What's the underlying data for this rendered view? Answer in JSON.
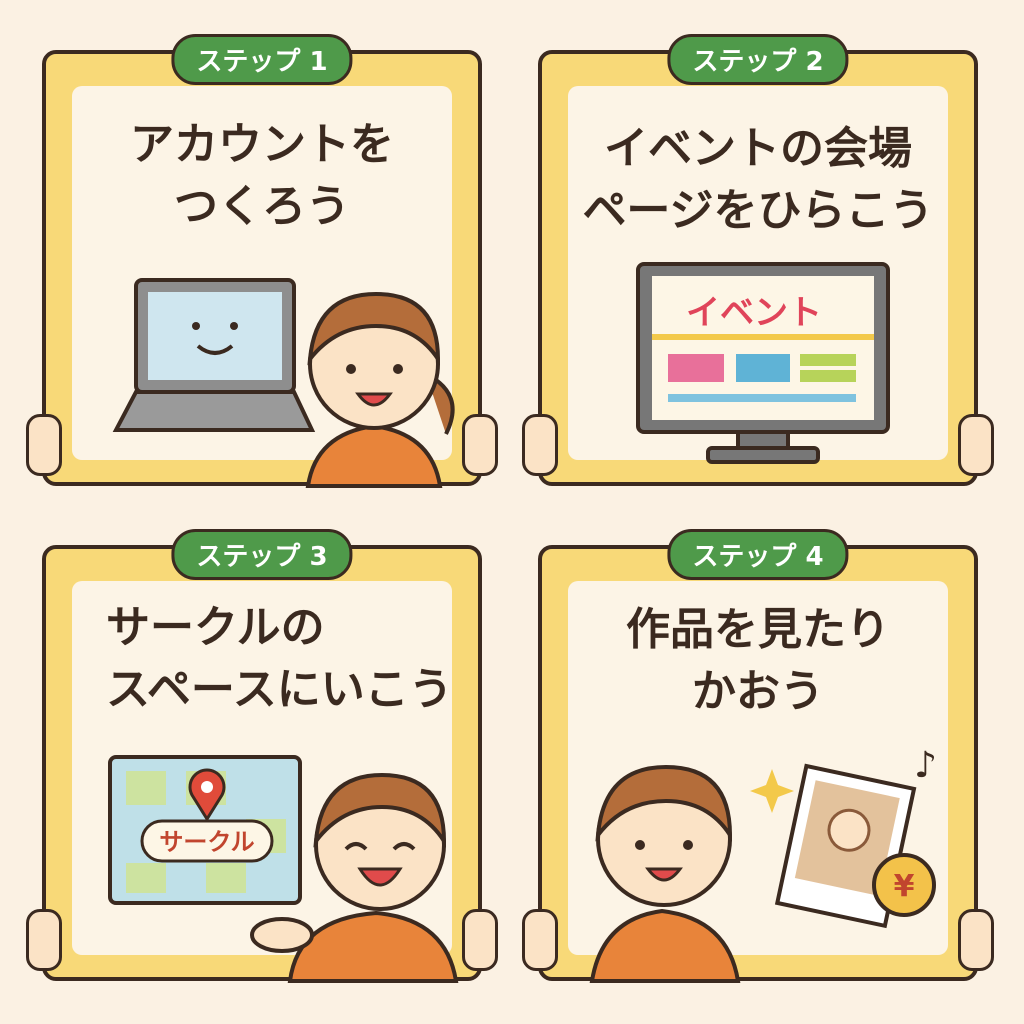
{
  "steps": [
    {
      "badge": "ステップ 1",
      "title_lines": [
        "アカウントを",
        "つくろう"
      ]
    },
    {
      "badge": "ステップ 2",
      "title_lines": [
        "イベントの会場",
        "ページをひらこう"
      ],
      "screen_text": "イベント"
    },
    {
      "badge": "ステップ 3",
      "title_lines": [
        "サークルの",
        "スペースにいこう"
      ],
      "map_label": "サークル"
    },
    {
      "badge": "ステップ 4",
      "title_lines": [
        "作品を見たり",
        "かおう"
      ],
      "coin_symbol": "¥",
      "note_symbol": "♪"
    }
  ],
  "colors": {
    "frame": "#f8d978",
    "badge": "#4f9a4a",
    "outline": "#3b2a20",
    "cream": "#fcf4e6",
    "shirt": "#e8843a"
  }
}
